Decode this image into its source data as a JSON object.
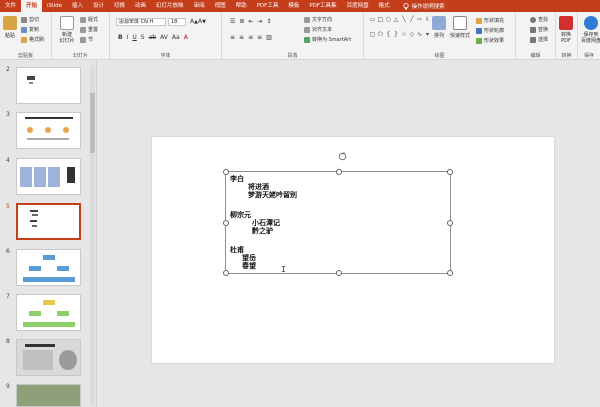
{
  "tabs": [
    "文件",
    "开始",
    "iSlide",
    "插入",
    "设计",
    "切换",
    "动画",
    "幻灯片放映",
    "审阅",
    "视图",
    "帮助",
    "PDF工具",
    "模板",
    "PDF工具集",
    "百度网盘",
    "格式"
  ],
  "active_tab_index": 1,
  "tell_me": "操作说明搜索",
  "ribbon": {
    "clipboard": {
      "paste": "粘贴",
      "cut": "剪切",
      "copy": "复制",
      "format_painter": "格式刷",
      "label": "剪贴板"
    },
    "slides": {
      "new_slide": "新建\n幻灯片",
      "layout": "版式",
      "reset": "重置",
      "section": "节",
      "label": "幻灯片"
    },
    "font": {
      "family": "思源宋体 CN H",
      "size": "18",
      "bold": "B",
      "italic": "I",
      "underline": "U",
      "strike": "S",
      "label": "字体"
    },
    "paragraph": {
      "text_direction": "文字方向",
      "align_text": "对齐文本",
      "smartart": "转换为 SmartArt",
      "label": "段落"
    },
    "drawing": {
      "arrange": "排列",
      "quick_styles": "快速样式",
      "fill": "形状填充",
      "outline": "形状轮廓",
      "effects": "形状效果",
      "label": "绘图"
    },
    "editing": {
      "find": "查找",
      "replace": "替换",
      "select": "选择",
      "label": "编辑"
    },
    "pdf": {
      "to_pdf": "转换\nPDF",
      "label": "转换"
    },
    "save_to": {
      "label": "保存到\n百度网盘",
      "group": "保存"
    }
  },
  "slide_numbers": [
    "2",
    "3",
    "4",
    "5",
    "6",
    "7",
    "8",
    "9"
  ],
  "selected_slide": "5",
  "textbox_lines": [
    {
      "text": "李白",
      "indent": 0
    },
    {
      "text": "将进酒",
      "indent": 2
    },
    {
      "text": "梦游天姥吟留别",
      "indent": 2
    },
    {
      "text": "",
      "indent": 0
    },
    {
      "text": "柳宗元",
      "indent": 0
    },
    {
      "text": "小石潭记",
      "indent": 2
    },
    {
      "text": "黔之驴",
      "indent": 2
    },
    {
      "text": "",
      "indent": 0
    },
    {
      "text": "杜甫",
      "indent": 0
    },
    {
      "text": "望岳",
      "indent": 1
    },
    {
      "text": "春望",
      "indent": 1
    }
  ],
  "colors": {
    "accent": "#c43e1c",
    "ribbon_bg": "#f3f3f3",
    "workspace": "#e6e6e6"
  }
}
